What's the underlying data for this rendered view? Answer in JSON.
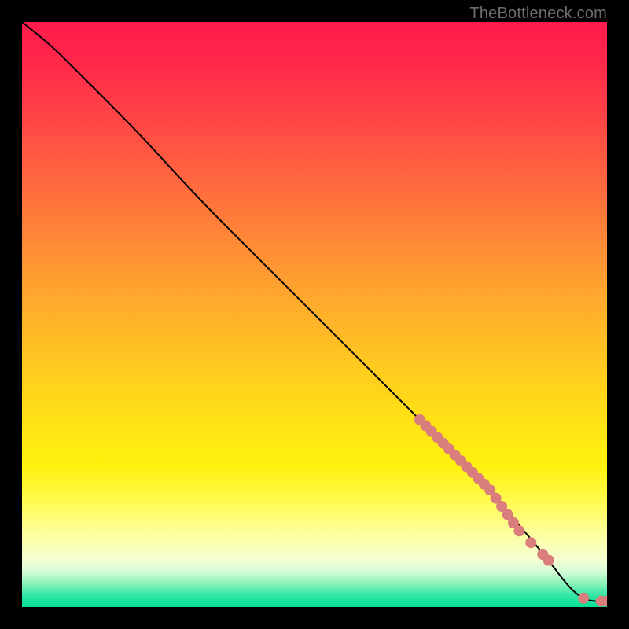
{
  "watermark": "TheBottleneck.com",
  "colors": {
    "line": "#000000",
    "marker": "#d97d7d",
    "frame_bg": "#000000"
  },
  "chart_data": {
    "type": "line",
    "title": "",
    "xlabel": "",
    "ylabel": "",
    "xlim": [
      0,
      100
    ],
    "ylim": [
      0,
      100
    ],
    "grid": false,
    "legend": false,
    "line_path_note": "Curve is a monotonically decreasing line from top-left toward bottom-right; initial segment is slightly convex then nearly straight; flattens near x≈95–100 at y≈1.",
    "line_samples": {
      "x": [
        0,
        5,
        10,
        20,
        30,
        40,
        50,
        60,
        70,
        75,
        80,
        85,
        90,
        93,
        95,
        97,
        100
      ],
      "y": [
        100,
        96,
        91,
        81,
        70,
        60,
        50,
        40,
        30,
        25,
        20,
        14,
        8,
        4,
        2,
        1,
        1
      ]
    },
    "markers": {
      "note": "Salmon filled circles lying on the line, clustered in the lower-right region (x≈68–100). Dense/overlapping run x≈68–90, sparse gap, then final points near the flat tail.",
      "series": [
        {
          "name": "points",
          "x_values": [
            68,
            69,
            70,
            71,
            72,
            73,
            74,
            75,
            76,
            77,
            78,
            79,
            80,
            81,
            82,
            83,
            84,
            85,
            87,
            89,
            90,
            96,
            99,
            100
          ],
          "y_values": [
            32,
            31,
            30,
            29,
            28,
            27,
            26,
            25,
            24,
            23,
            22,
            21,
            20,
            18.6,
            17.2,
            15.8,
            14.4,
            13,
            11,
            9,
            8,
            1.5,
            1,
            1
          ]
        }
      ]
    }
  }
}
